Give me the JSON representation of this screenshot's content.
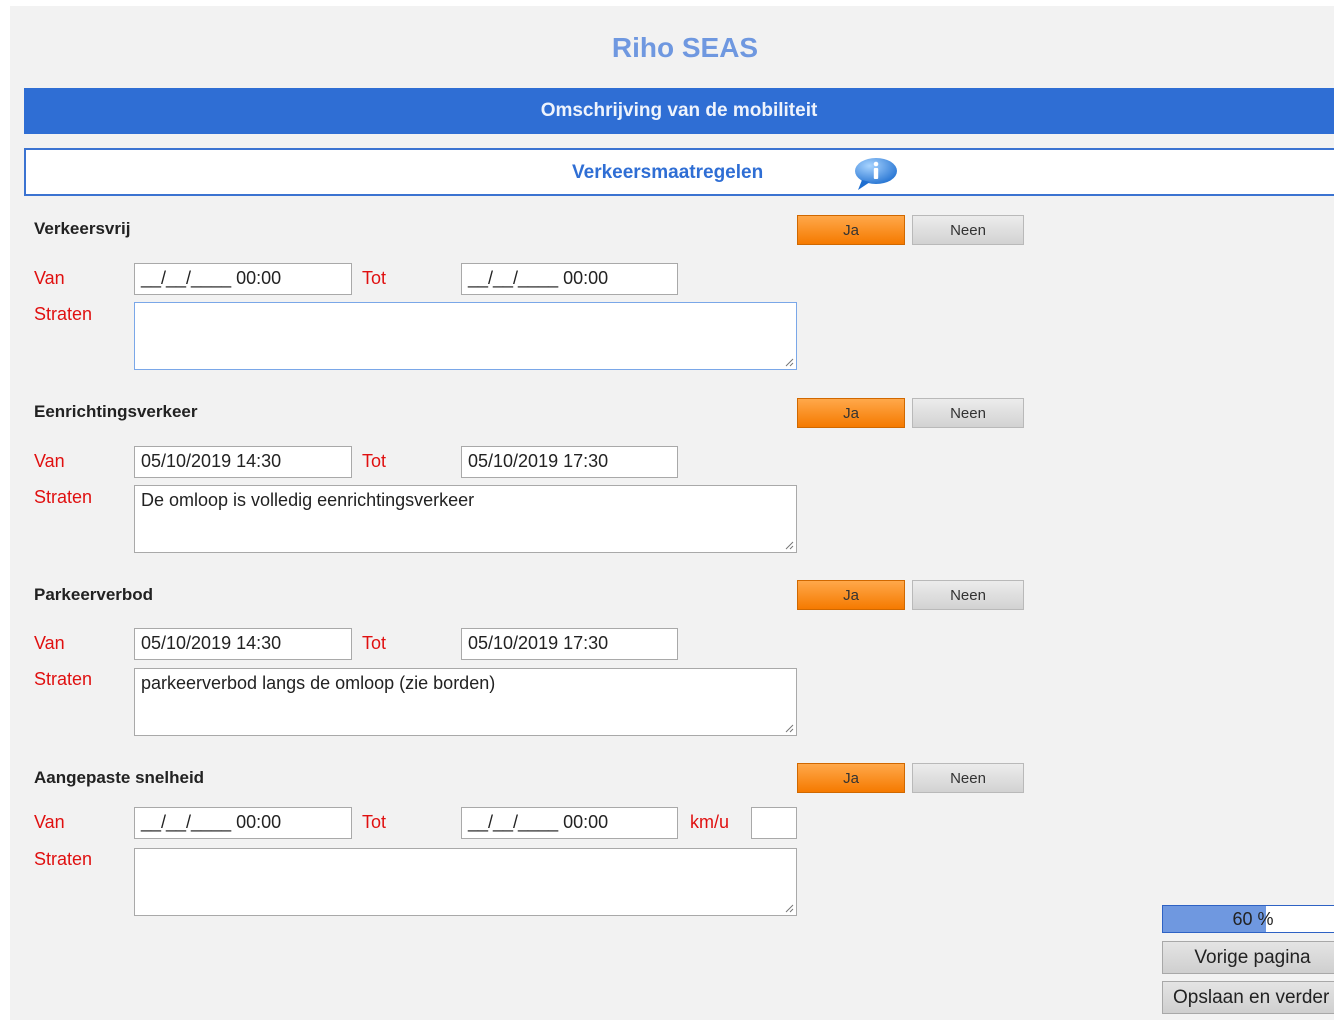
{
  "app_title": "Riho SEAS",
  "main_banner": "Omschrijving van de mobiliteit",
  "sub_banner": {
    "title": "Verkeersmaatregelen",
    "icon": "info-icon"
  },
  "labels": {
    "van": "Van",
    "tot": "Tot",
    "straten": "Straten",
    "kmu": "km/u"
  },
  "toggle": {
    "ja": "Ja",
    "neen": "Neen"
  },
  "sections": [
    {
      "title": "Verkeersvrij",
      "van": "__/__/____ 00:00",
      "tot": "__/__/____ 00:00",
      "straten": ""
    },
    {
      "title": "Eenrichtingsverkeer",
      "van": "05/10/2019 14:30",
      "tot": "05/10/2019 17:30",
      "straten": "De omloop is volledig eenrichtingsverkeer"
    },
    {
      "title": "Parkeerverbod",
      "van": "05/10/2019 14:30",
      "tot": "05/10/2019 17:30",
      "straten": "parkeerverbod langs de omloop (zie borden)"
    },
    {
      "title": "Aangepaste snelheid",
      "van": "__/__/____ 00:00",
      "tot": "__/__/____ 00:00",
      "kmu": "",
      "straten": ""
    }
  ],
  "progress": {
    "value": 0.6,
    "text": "60 %"
  },
  "nav": {
    "previous": "Vorige pagina",
    "save_next": "Opslaan en verder"
  },
  "colors": {
    "accent": "#2f6ed4",
    "label_red": "#e01010",
    "ja_orange": "#f57a00"
  }
}
